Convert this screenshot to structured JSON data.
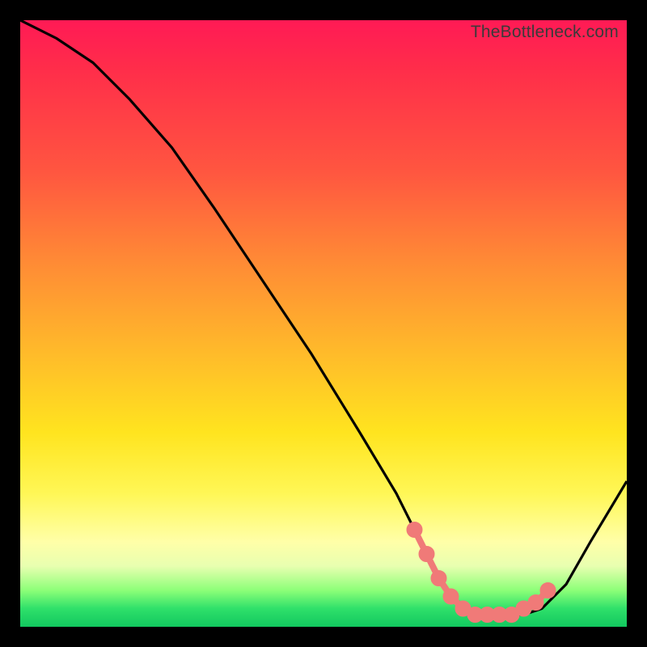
{
  "watermark": "TheBottleneck.com",
  "chart_data": {
    "type": "line",
    "title": "",
    "xlabel": "",
    "ylabel": "",
    "xlim": [
      0,
      100
    ],
    "ylim": [
      0,
      100
    ],
    "series": [
      {
        "name": "bottleneck-curve",
        "x": [
          0,
          6,
          12,
          18,
          25,
          32,
          40,
          48,
          56,
          62,
          65,
          68,
          71,
          74,
          77,
          80,
          83,
          86,
          90,
          94,
          97,
          100
        ],
        "y": [
          100,
          97,
          93,
          87,
          79,
          69,
          57,
          45,
          32,
          22,
          16,
          10,
          5,
          3,
          2,
          2,
          2,
          3,
          7,
          14,
          19,
          24
        ]
      }
    ],
    "markers": {
      "name": "highlight-dots",
      "x": [
        65,
        67,
        69,
        71,
        73,
        75,
        77,
        79,
        81,
        83,
        85,
        87
      ],
      "y": [
        16,
        12,
        8,
        5,
        3,
        2,
        2,
        2,
        2,
        3,
        4,
        6
      ]
    },
    "gradient_stops": [
      {
        "pos": 0,
        "color": "#ff1a55"
      },
      {
        "pos": 25,
        "color": "#ff5640"
      },
      {
        "pos": 55,
        "color": "#ffbb2a"
      },
      {
        "pos": 78,
        "color": "#fff756"
      },
      {
        "pos": 94,
        "color": "#8cff78"
      },
      {
        "pos": 100,
        "color": "#12c85f"
      }
    ]
  }
}
